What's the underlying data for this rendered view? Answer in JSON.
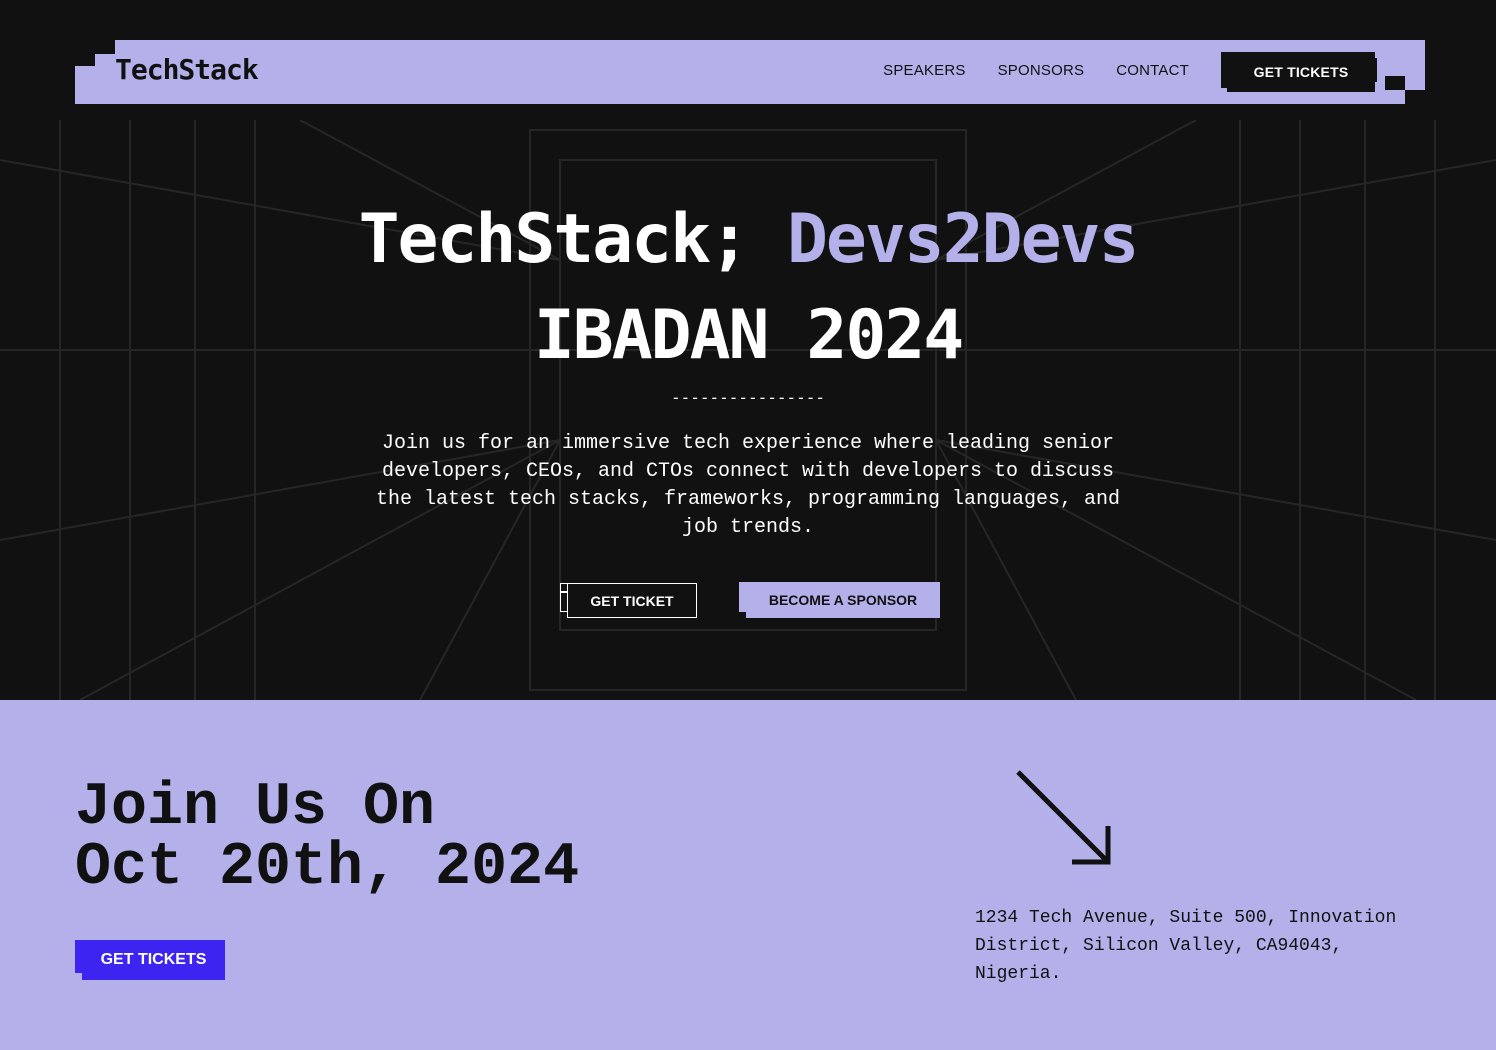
{
  "header": {
    "logo": "TechStack",
    "nav": [
      "SPEAKERS",
      "SPONSORS",
      "CONTACT"
    ],
    "cta_label": "GET TICKETS"
  },
  "hero": {
    "title_part1": "TechStack;",
    "title_part2": "Devs2Devs",
    "title_line2": "IBADAN 2024",
    "divider": "----------------",
    "description": "Join us for an immersive tech experience where leading senior developers, CEOs, and CTOs connect with developers to discuss the latest tech stacks, frameworks, programming languages, and job trends.",
    "ticket_label": "GET TICKET",
    "sponsor_label": "BECOME A SPONSOR"
  },
  "event": {
    "join_line1": "Join Us On",
    "join_line2": "Oct 20th, 2024",
    "cta_label": "GET TICKETS",
    "address": "1234 Tech Avenue, Suite 500, Innovation District, Silicon Valley, CA94043, Nigeria.",
    "arrow_icon": "arrow-down-right-icon"
  },
  "colors": {
    "background": "#111111",
    "lavender": "#b3b0ea",
    "blue": "#3d24f0",
    "white": "#ffffff"
  }
}
